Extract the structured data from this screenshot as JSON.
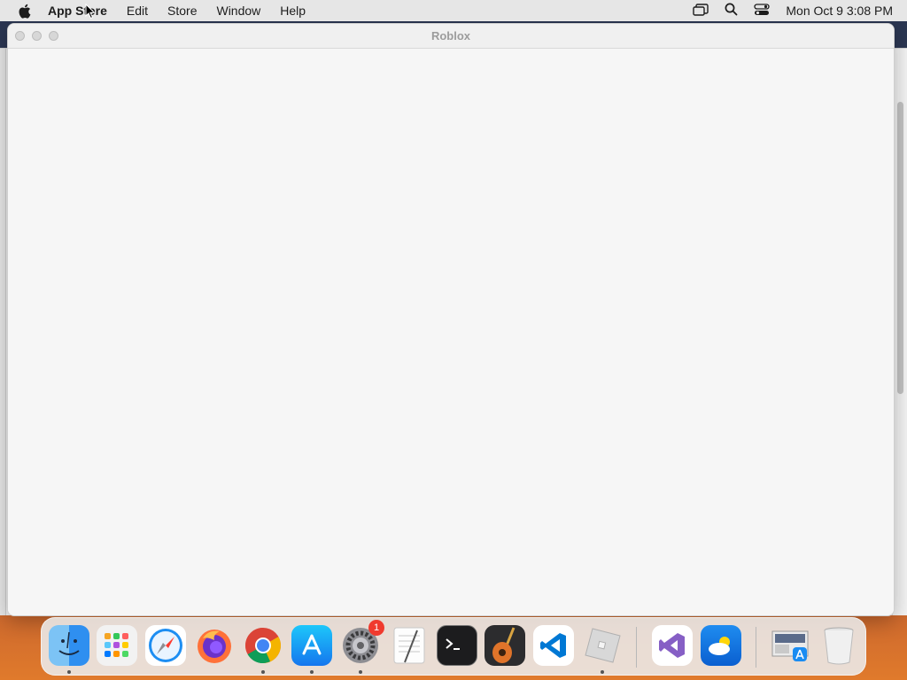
{
  "menubar": {
    "items": [
      "App Store",
      "Edit",
      "Store",
      "Window",
      "Help"
    ],
    "clock": "Mon Oct 9  3:08 PM"
  },
  "window": {
    "title": "Roblox"
  },
  "dock": {
    "items": [
      {
        "name": "finder-icon",
        "running": true
      },
      {
        "name": "launchpad-icon",
        "running": false
      },
      {
        "name": "safari-icon",
        "running": false
      },
      {
        "name": "firefox-icon",
        "running": false
      },
      {
        "name": "chrome-icon",
        "running": true
      },
      {
        "name": "app-store-icon",
        "running": true
      },
      {
        "name": "system-settings-icon",
        "running": true,
        "badge": "1"
      },
      {
        "name": "textedit-icon",
        "running": false
      },
      {
        "name": "terminal-icon",
        "running": false
      },
      {
        "name": "garageband-icon",
        "running": false
      },
      {
        "name": "vscode-icon",
        "running": false
      },
      {
        "name": "roblox-icon",
        "running": true
      },
      {
        "name": "visual-studio-icon",
        "running": false
      },
      {
        "name": "weather-icon",
        "running": false
      },
      {
        "name": "downloads-stack-icon",
        "running": false
      },
      {
        "name": "trash-icon",
        "running": false
      }
    ],
    "badge": "1"
  }
}
